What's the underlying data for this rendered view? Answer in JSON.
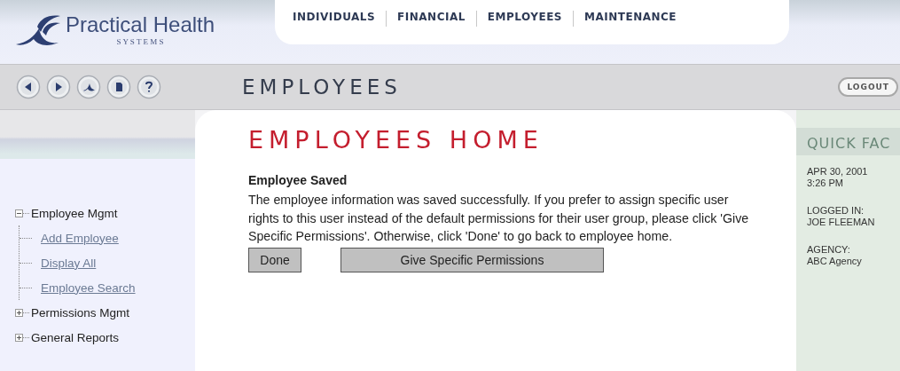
{
  "logo": {
    "name": "Practical Health",
    "tagline": "S Y S T E M S"
  },
  "nav": [
    {
      "label": "INDIVIDUALS"
    },
    {
      "label": "FINANCIAL"
    },
    {
      "label": "EMPLOYEES"
    },
    {
      "label": "MAINTENANCE"
    }
  ],
  "section_title": "EMPLOYEES",
  "logout": "LOGOUT",
  "sidebar": {
    "tree": [
      {
        "label": "Employee Mgmt",
        "expanded": true,
        "children": [
          {
            "label": "Add Employee"
          },
          {
            "label": "Display All"
          },
          {
            "label": "Employee Search"
          }
        ]
      },
      {
        "label": "Permissions Mgmt",
        "expanded": false
      },
      {
        "label": "General Reports",
        "expanded": false
      }
    ]
  },
  "main": {
    "title": "EMPLOYEES HOME",
    "heading": "Employee Saved",
    "message": "The employee information was saved successfully. If you prefer to assign specific user rights to this user instead of the default permissions for their user group, please click 'Give Specific Permissions'. Otherwise, click 'Done' to go back to employee home.",
    "buttons": [
      "Done",
      "Give Specific Permissions"
    ]
  },
  "quick_facts": {
    "title": "QUICK FAC",
    "groups": [
      [
        "APR 30, 2001",
        "3:26 PM"
      ],
      [
        "LOGGED IN:",
        "JOE FLEEMAN"
      ],
      [
        "AGENCY:",
        "ABC Agency"
      ]
    ]
  }
}
